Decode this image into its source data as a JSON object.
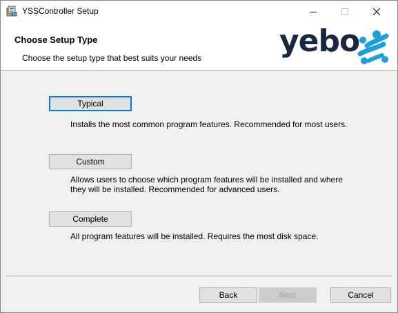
{
  "window": {
    "title": "YSSController Setup",
    "icon": "installer-icon"
  },
  "header": {
    "title": "Choose Setup Type",
    "subtitle": "Choose the setup type that best suits your needs",
    "logo_text": "yebo",
    "logo_colors": {
      "word": "#1a2740",
      "mark": "#1e9fd6"
    }
  },
  "options": [
    {
      "label": "Typical",
      "description": [
        "Installs the most common program features. Recommended for most users."
      ]
    },
    {
      "label": "Custom",
      "description": [
        "Allows users to choose which program features will be installed and where",
        "they will be installed. Recommended for advanced users."
      ]
    },
    {
      "label": "Complete",
      "description": [
        "All program features will be installed. Requires the most disk space."
      ]
    }
  ],
  "footer": {
    "back_label": "Back",
    "next_label": "Next",
    "cancel_label": "Cancel"
  },
  "colors": {
    "focus": "#0078d7",
    "button_face": "#e1e1e1",
    "dialog_bg": "#f0f0f0"
  }
}
